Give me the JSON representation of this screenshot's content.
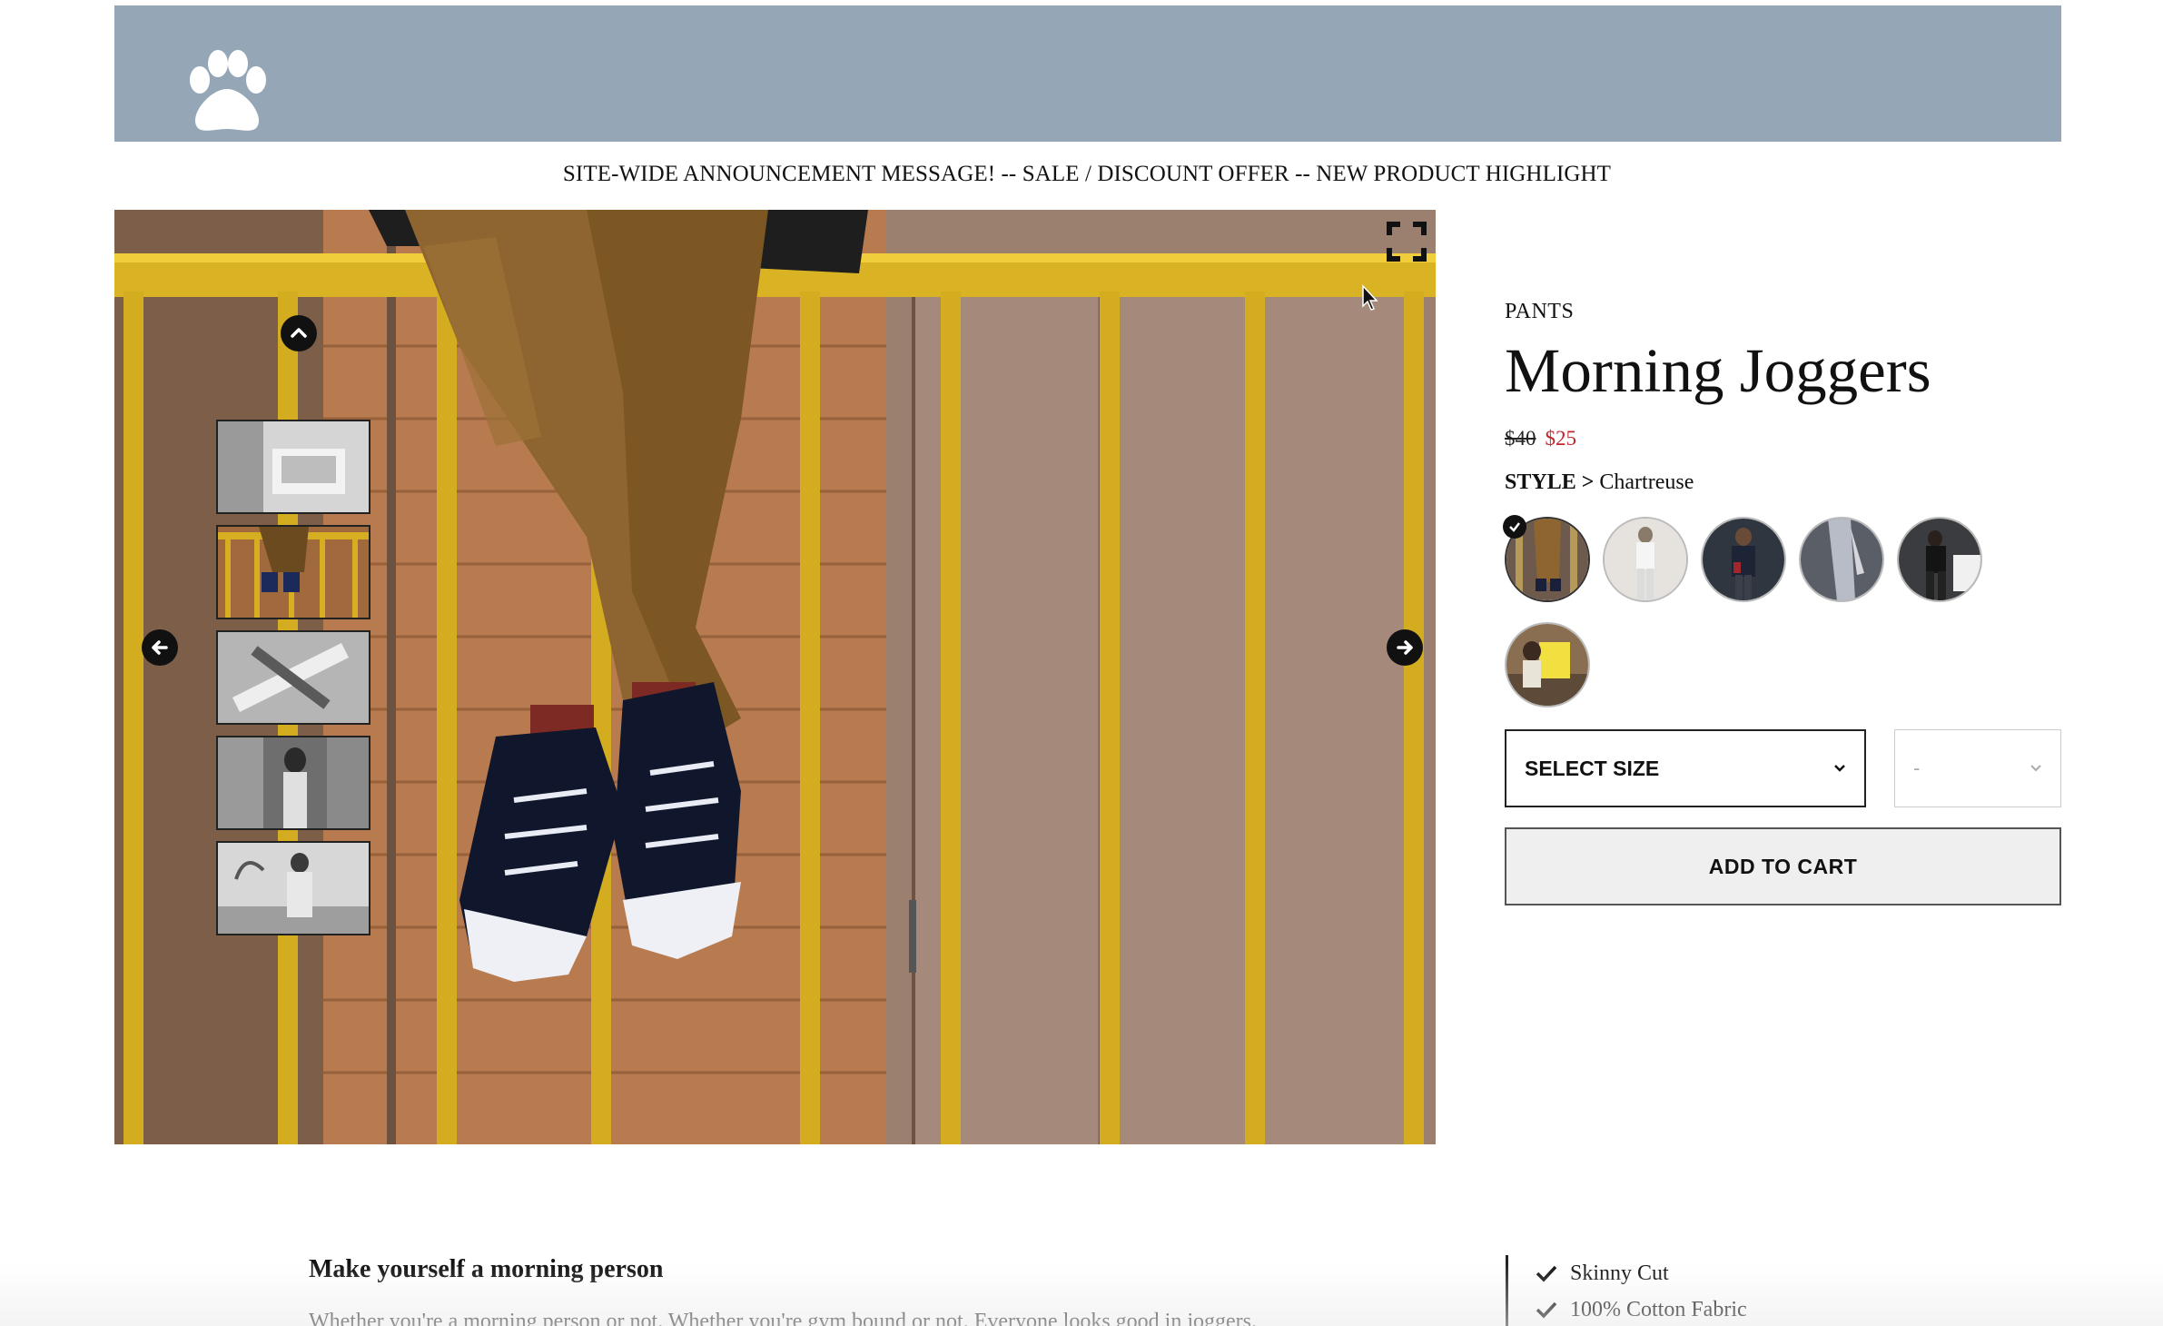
{
  "header": {
    "logo_icon": "paw-icon",
    "background": "#95a7b7"
  },
  "announcement": "SITE-WIDE ANNOUNCEMENT MESSAGE! -- SALE / DISCOUNT OFFER -- NEW PRODUCT HIGHLIGHT",
  "gallery": {
    "icons": {
      "fullscreen": "fullscreen-icon",
      "up": "chevron-up-icon",
      "prev": "arrow-left-icon",
      "next": "arrow-right-icon"
    },
    "thumbnail_count": 5,
    "selected_thumbnail": 2
  },
  "product": {
    "category": "PANTS",
    "title": "Morning Joggers",
    "old_price": "$40",
    "sale_price": "$25",
    "sale_color": "#c0262f",
    "style_label": "STYLE >",
    "style_value": "Chartreuse",
    "swatch_count": 6,
    "selected_swatch": 1,
    "size_select": "SELECT SIZE",
    "qty_select": "-",
    "add_to_cart": "ADD TO CART"
  },
  "description": {
    "heading": "Make yourself a morning person",
    "text": "Whether you're a morning person or not. Whether you're gym bound or not. Everyone looks good in joggers."
  },
  "features": [
    "Skinny Cut",
    "100% Cotton Fabric"
  ]
}
